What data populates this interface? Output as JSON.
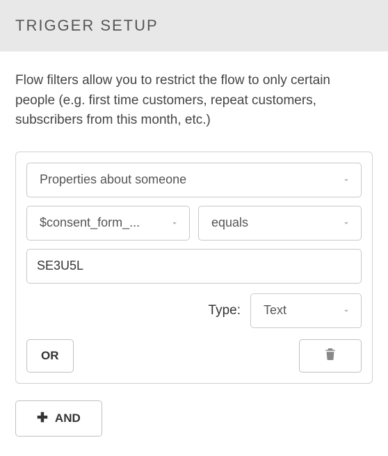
{
  "header": {
    "title": "TRIGGER SETUP"
  },
  "description": "Flow filters allow you to restrict the flow to only certain people (e.g. first time customers, repeat customers, subscribers from this month, etc.)",
  "filter": {
    "property_category": "Properties about someone",
    "property_name": "$consent_form_...",
    "operator": "equals",
    "value": "SE3U5L",
    "type_label": "Type:",
    "type_value": "Text",
    "or_label": "OR"
  },
  "and_button": {
    "label": "AND"
  }
}
